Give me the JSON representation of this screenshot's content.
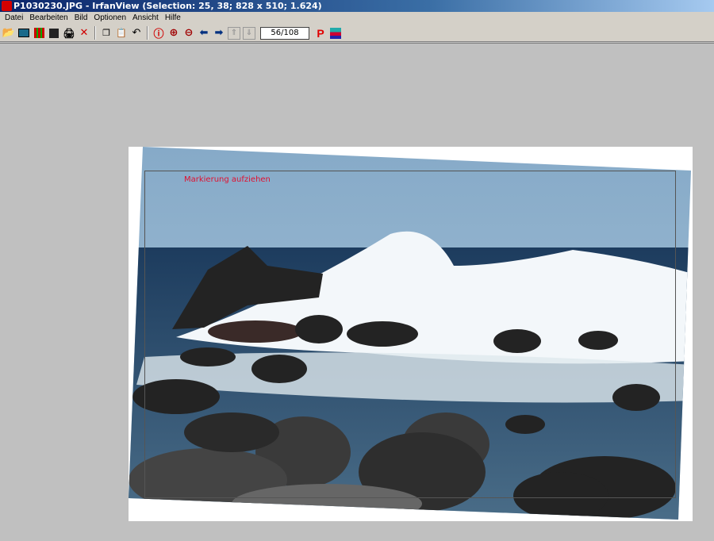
{
  "window": {
    "title": "P1030230.JPG - IrfanView (Selection: 25, 38; 828 x 510; 1.624)"
  },
  "menu": [
    "Datei",
    "Bearbeiten",
    "Bild",
    "Optionen",
    "Ansicht",
    "Hilfe"
  ],
  "toolbar": {
    "page_counter": "56/108",
    "p_label": "P"
  },
  "canvas": {
    "selection_hint": "Markierung aufziehen"
  }
}
